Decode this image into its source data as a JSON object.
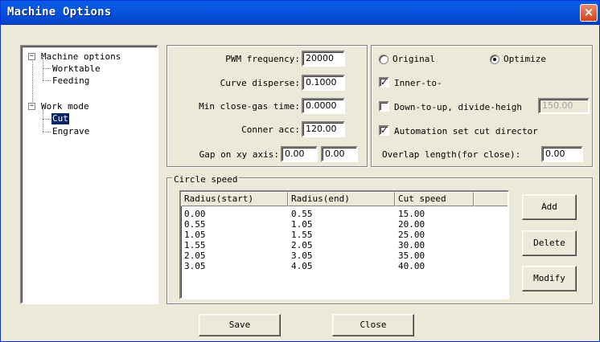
{
  "window": {
    "title": "Machine Options",
    "close_glyph": "×"
  },
  "tree": {
    "root_machine": "Machine options",
    "worktable": "Worktable",
    "feeding": "Feeding",
    "root_work": "Work mode",
    "cut": "Cut",
    "engrave": "Engrave",
    "expander_glyph": "−"
  },
  "settings": {
    "pwm_label": "PWM frequency:",
    "pwm_value": "20000",
    "curve_label": "Curve disperse:",
    "curve_value": "0.1000",
    "minclose_label": "Min close-gas time:",
    "minclose_value": "0.0000",
    "conner_label": "Conner acc:",
    "conner_value": "120.00",
    "gap_label": "Gap on xy axis:",
    "gap_x": "0.00",
    "gap_y": "0.00"
  },
  "options": {
    "original_label": "Original",
    "original_selected": false,
    "optimize_label": "Optimize",
    "optimize_selected": true,
    "inner_label": "Inner-to-",
    "inner_checked": true,
    "downup_label": "Down-to-up, divide-heigh",
    "downup_checked": false,
    "downup_value": "150.00",
    "auto_label": "Automation set cut director",
    "auto_checked": true,
    "overlap_label": "Overlap length(for close):",
    "overlap_value": "0.00",
    "check_glyph": "✓"
  },
  "circle_speed": {
    "legend": "Circle speed",
    "columns": [
      "Radius(start)",
      "Radius(end)",
      "Cut speed",
      ""
    ],
    "rows": [
      [
        "0.00",
        "0.55",
        "15.00"
      ],
      [
        "0.55",
        "1.05",
        "20.00"
      ],
      [
        "1.05",
        "1.55",
        "25.00"
      ],
      [
        "1.55",
        "2.05",
        "30.00"
      ],
      [
        "2.05",
        "3.05",
        "35.00"
      ],
      [
        "3.05",
        "4.05",
        "40.00"
      ]
    ],
    "add_label": "Add",
    "delete_label": "Delete",
    "modify_label": "Modify"
  },
  "footer": {
    "save_label": "Save",
    "close_label": "Close"
  }
}
